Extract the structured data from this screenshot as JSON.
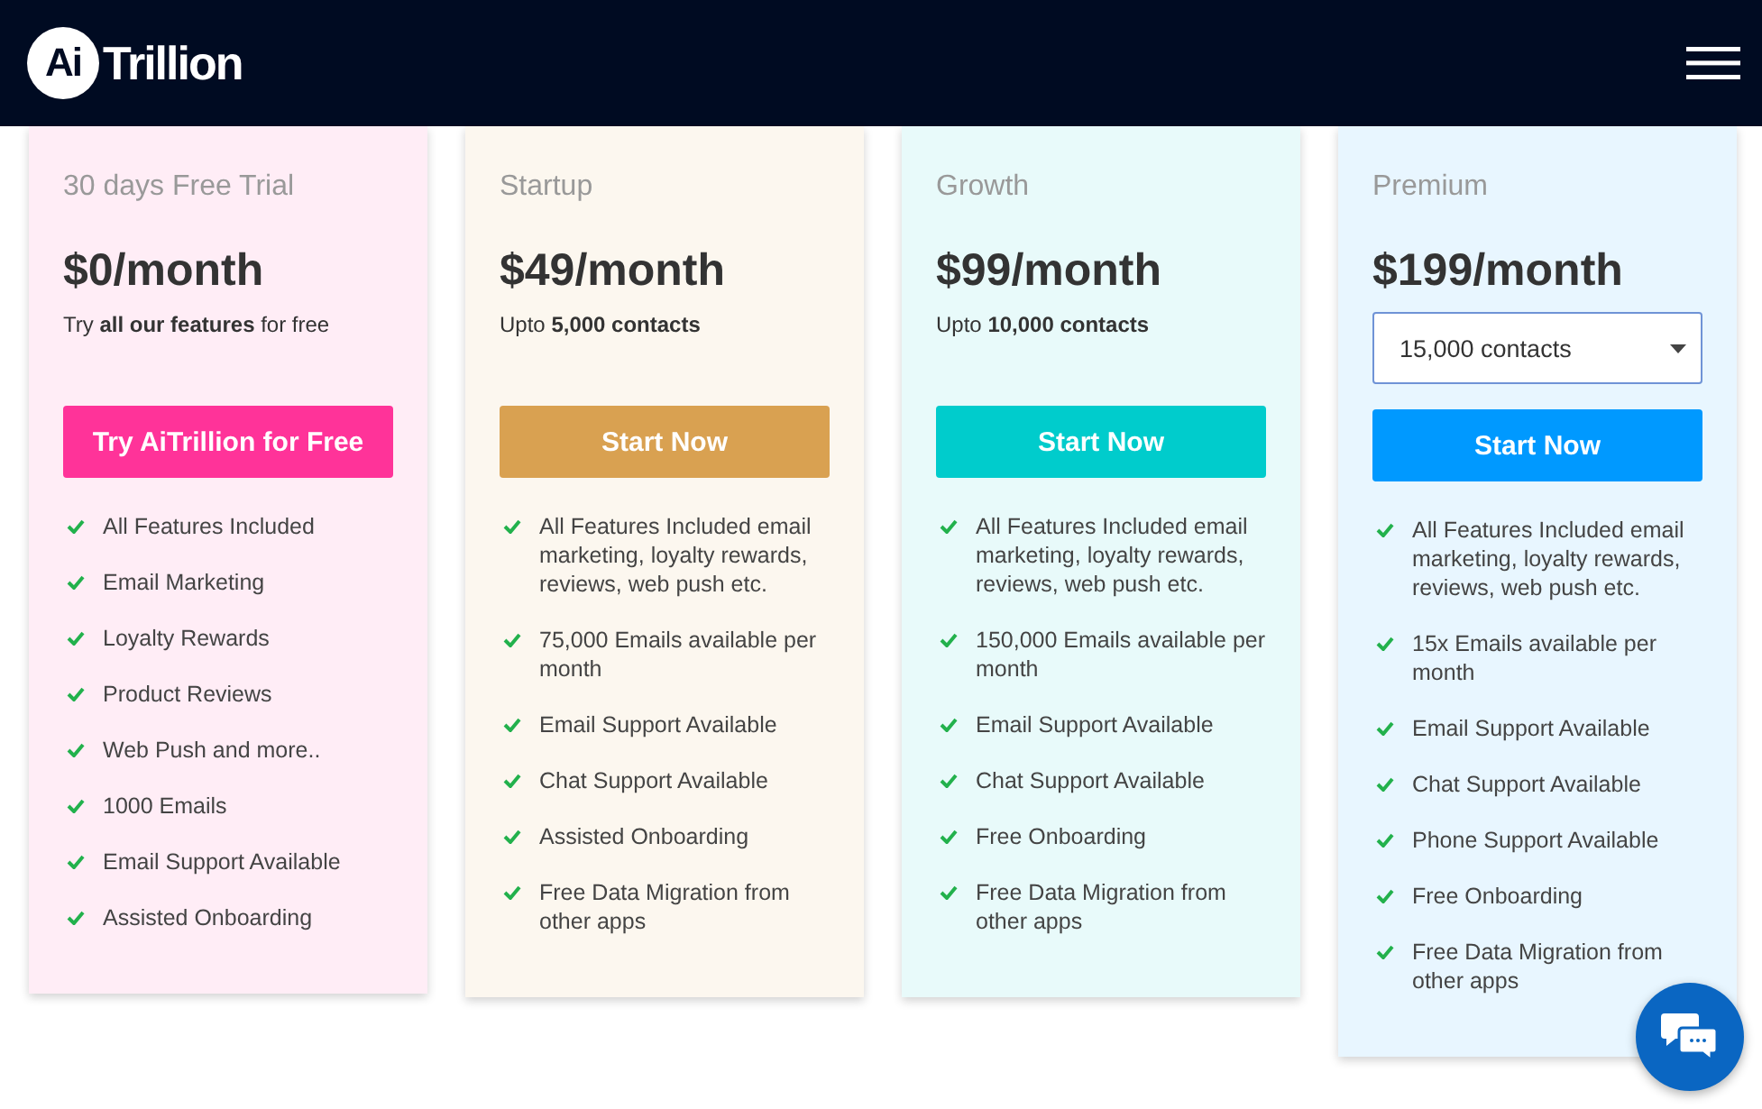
{
  "header": {
    "logo": {
      "mark": "Ai",
      "name": "Trillion"
    }
  },
  "plans": [
    {
      "title": "30 days Free Trial",
      "price": "$0/month",
      "subtitle": "Try **all our features** for free",
      "button": "Try AiTrillion for Free",
      "color": "#ff3399",
      "features": [
        "All Features Included",
        "Email Marketing",
        "Loyalty Rewards",
        "Product Reviews",
        "Web Push and more..",
        "1000 Emails",
        "Email Support Available",
        "Assisted Onboarding"
      ]
    },
    {
      "title": "Startup",
      "price": "$49/month",
      "subtitle": "Upto **5,000 contacts**",
      "button": "Start Now",
      "color": "#d9a151",
      "features": [
        "All Features Included email marketing, loyalty rewards, reviews, web push etc.",
        "75,000 Emails available per month",
        "Email Support Available",
        "Chat Support Available",
        "Assisted Onboarding",
        "Free Data Migration from other apps"
      ]
    },
    {
      "title": "Growth",
      "price": "$99/month",
      "subtitle": "Upto **10,000 contacts**",
      "button": "Start Now",
      "color": "#00cccc",
      "features": [
        "All Features Included email marketing, loyalty rewards, reviews, web push etc.",
        "150,000 Emails available per month",
        "Email Support Available",
        "Chat Support Available",
        "Free Onboarding",
        "Free Data Migration from other apps"
      ]
    },
    {
      "title": "Premium",
      "price": "$199/month",
      "contacts_select": {
        "value": "15,000 contacts"
      },
      "button": "Start Now",
      "color": "#0099ff",
      "features": [
        "All Features Included email marketing, loyalty rewards, reviews, web push etc.",
        "15x Emails available per month",
        "Email Support Available",
        "Chat Support Available",
        "Phone Support Available",
        "Free Onboarding",
        "Free Data Migration from other apps"
      ]
    }
  ]
}
